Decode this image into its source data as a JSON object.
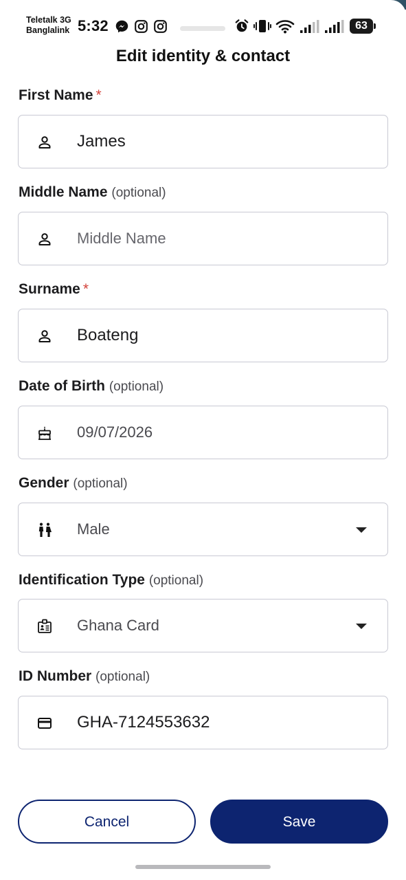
{
  "status_bar": {
    "carrier_1": "Teletalk 3G",
    "carrier_2": "Banglalink",
    "time": "5:32",
    "battery": "63",
    "icons": [
      "messenger-icon",
      "instagram-icon",
      "instagram-icon",
      "alarm-icon",
      "vibrate-icon",
      "wifi-icon",
      "signal-icon",
      "signal-icon",
      "battery-icon"
    ]
  },
  "page": {
    "title": "Edit identity & contact"
  },
  "form": {
    "required_mark": "*",
    "optional_tag": "(optional)",
    "first_name": {
      "label": "First Name",
      "value": "James",
      "icon": "person-icon"
    },
    "middle_name": {
      "label": "Middle Name",
      "placeholder": "Middle Name",
      "icon": "person-icon"
    },
    "surname": {
      "label": "Surname",
      "value": "Boateng",
      "icon": "person-icon"
    },
    "dob": {
      "label": "Date of Birth",
      "value": "09/07/2026",
      "icon": "cake-icon"
    },
    "gender": {
      "label": "Gender",
      "value": "Male",
      "icon": "people-icon"
    },
    "id_type": {
      "label": "Identification Type",
      "value": "Ghana Card",
      "icon": "badge-icon"
    },
    "id_number": {
      "label": "ID Number",
      "value": "GHA-7124553632",
      "icon": "card-icon"
    }
  },
  "actions": {
    "cancel_label": "Cancel",
    "save_label": "Save"
  },
  "colors": {
    "primary": "#0d2470",
    "required": "#d3423a",
    "border": "#c8c9d3"
  }
}
